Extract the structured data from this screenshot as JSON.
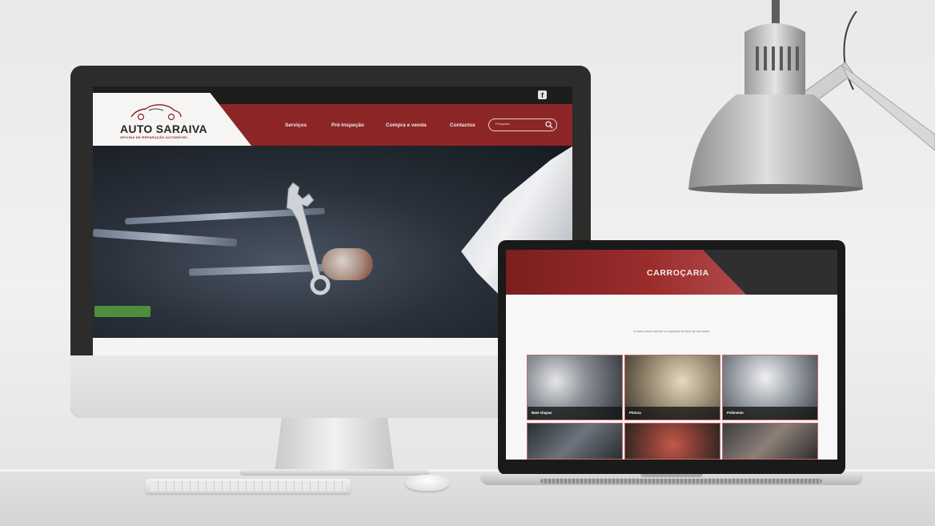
{
  "monitor_site": {
    "logo": {
      "title": "AUTO SARAIVA",
      "subtitle": "OFICINA DE REPARAÇÃO AUTOMÓVEL"
    },
    "social_icon": "facebook-icon",
    "nav": [
      "Serviços",
      "Pré-Inspeção",
      "Compra e venda",
      "Contactos"
    ],
    "search": {
      "placeholder": "Pesquisar",
      "icon": "search-icon"
    },
    "colors": {
      "brand_red": "#8c2626",
      "topbar": "#1e1d1c",
      "logo_bg": "#f7f5f3"
    }
  },
  "laptop_site": {
    "page_title": "CARROÇARIA",
    "intro": "A nossa oficina oferece os seguintes serviços de carroçaria:",
    "services": [
      "Bate-chapas",
      "Pintura",
      "Polimento"
    ]
  }
}
